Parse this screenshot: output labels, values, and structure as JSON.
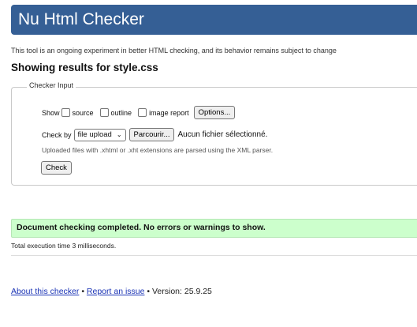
{
  "header": {
    "title": "Nu Html Checker",
    "bg_color": "#355f95"
  },
  "intro_text": "This tool is an ongoing experiment in better HTML checking, and its behavior remains subject to change",
  "results_title": "Showing results for style.css",
  "checker_input": {
    "legend": "Checker Input",
    "show_label": "Show",
    "options": [
      {
        "label": "source",
        "checked": false
      },
      {
        "label": "outline",
        "checked": false
      },
      {
        "label": "image report",
        "checked": false
      }
    ],
    "options_button": "Options...",
    "check_by_label": "Check by",
    "check_by_value": "file upload",
    "browse_button": "Parcourir...",
    "no_file_text": "Aucun fichier sélectionné.",
    "parser_note": "Uploaded files with .xhtml or .xht extensions are parsed using the XML parser.",
    "check_button": "Check"
  },
  "result": {
    "message": "Document checking completed. No errors or warnings to show.",
    "bg_color": "#ccffcc"
  },
  "execution_time": "Total execution time 3 milliseconds.",
  "footer": {
    "about_link": "About this checker",
    "sep1": "•",
    "report_link": "Report an issue",
    "sep2": "•",
    "version": "Version: 25.9.25",
    "link_color": "#1a33b5"
  }
}
